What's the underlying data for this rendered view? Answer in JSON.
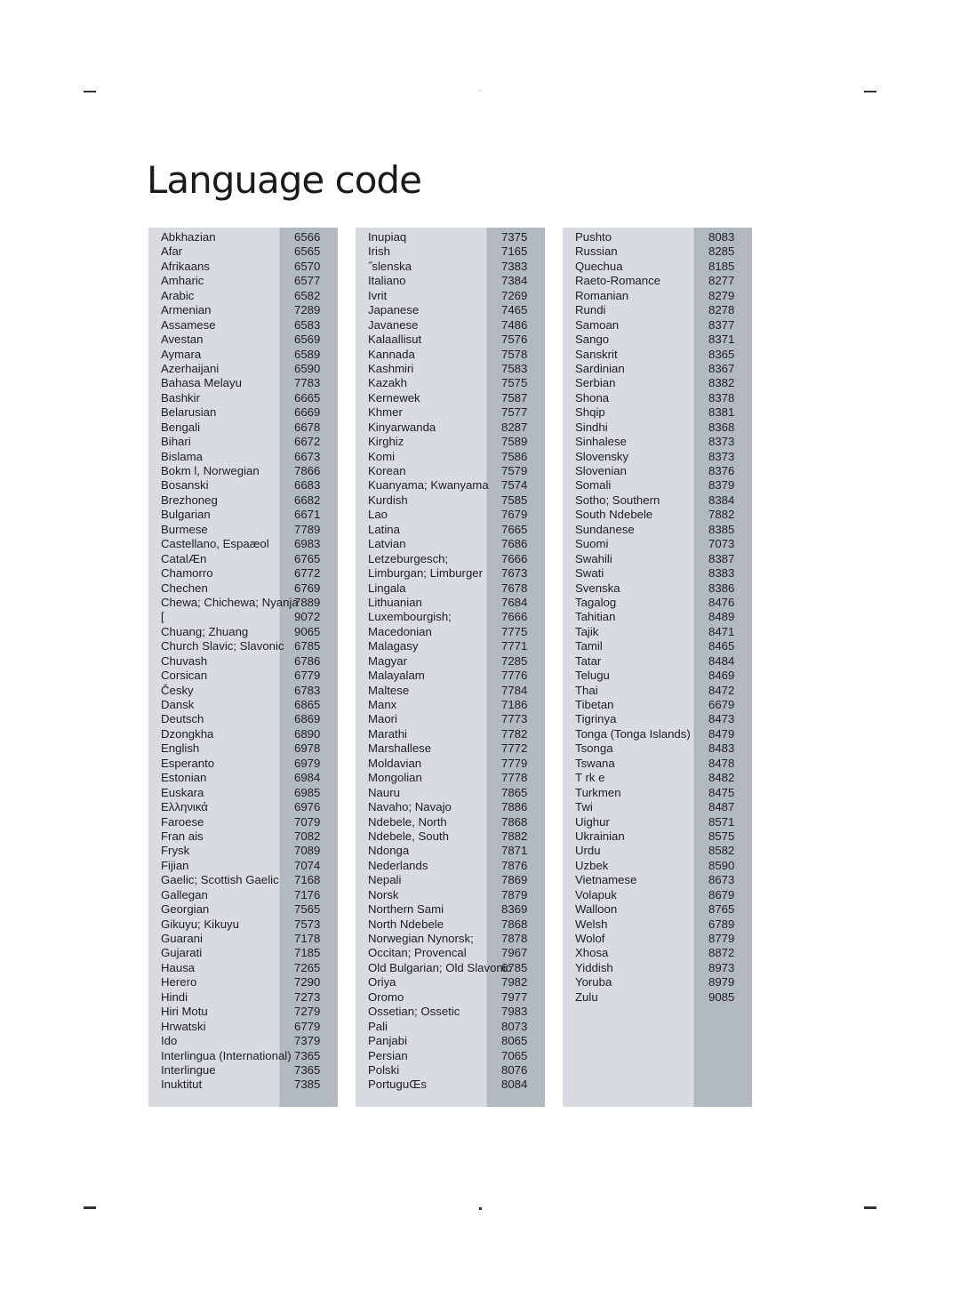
{
  "page": {
    "title": "Language code"
  },
  "columns": [
    {
      "entries": [
        {
          "name": "Abkhazian",
          "code": "6566"
        },
        {
          "name": "Afar",
          "code": "6565"
        },
        {
          "name": "Afrikaans",
          "code": "6570"
        },
        {
          "name": "Amharic",
          "code": "6577"
        },
        {
          "name": "Arabic",
          "code": "6582"
        },
        {
          "name": "Armenian",
          "code": "7289"
        },
        {
          "name": "Assamese",
          "code": "6583"
        },
        {
          "name": "Avestan",
          "code": "6569"
        },
        {
          "name": "Aymara",
          "code": "6589"
        },
        {
          "name": "Azerhaijani",
          "code": "6590"
        },
        {
          "name": "Bahasa Melayu",
          "code": "7783"
        },
        {
          "name": "Bashkir",
          "code": "6665"
        },
        {
          "name": "Belarusian",
          "code": "6669"
        },
        {
          "name": "Bengali",
          "code": "6678"
        },
        {
          "name": "Bihari",
          "code": "6672"
        },
        {
          "name": "Bislama",
          "code": "6673"
        },
        {
          "name": "Bokm l, Norwegian",
          "code": "7866"
        },
        {
          "name": "Bosanski",
          "code": "6683"
        },
        {
          "name": "Brezhoneg",
          "code": "6682"
        },
        {
          "name": "Bulgarian",
          "code": "6671"
        },
        {
          "name": "Burmese",
          "code": "7789"
        },
        {
          "name": "Castellano, Espaæol",
          "code": "6983"
        },
        {
          "name": "CatalÆn",
          "code": "6765"
        },
        {
          "name": "Chamorro",
          "code": "6772"
        },
        {
          "name": "Chechen",
          "code": "6769"
        },
        {
          "name": "Chewa; Chichewa; Nyanja",
          "code": "7889"
        },
        {
          "name": "[",
          "code": "9072"
        },
        {
          "name": "Chuang; Zhuang",
          "code": "9065"
        },
        {
          "name": "Church Slavic; Slavonic",
          "code": "6785"
        },
        {
          "name": "Chuvash",
          "code": "6786"
        },
        {
          "name": "Corsican",
          "code": "6779"
        },
        {
          "name": "Česky",
          "code": "6783"
        },
        {
          "name": "Dansk",
          "code": "6865"
        },
        {
          "name": "Deutsch",
          "code": "6869"
        },
        {
          "name": "Dzongkha",
          "code": "6890"
        },
        {
          "name": "English",
          "code": "6978"
        },
        {
          "name": "Esperanto",
          "code": "6979"
        },
        {
          "name": "Estonian",
          "code": "6984"
        },
        {
          "name": "Euskara",
          "code": "6985"
        },
        {
          "name": "Ελληνικά",
          "code": "6976"
        },
        {
          "name": "Faroese",
          "code": "7079"
        },
        {
          "name": "Fran ais",
          "code": "7082"
        },
        {
          "name": "Frysk",
          "code": "7089"
        },
        {
          "name": "Fijian",
          "code": "7074"
        },
        {
          "name": "Gaelic; Scottish Gaelic",
          "code": "7168"
        },
        {
          "name": "Gallegan",
          "code": "7176"
        },
        {
          "name": "Georgian",
          "code": "7565"
        },
        {
          "name": "Gikuyu; Kikuyu",
          "code": "7573"
        },
        {
          "name": "Guarani",
          "code": "7178"
        },
        {
          "name": "Gujarati",
          "code": "7185"
        },
        {
          "name": "Hausa",
          "code": "7265"
        },
        {
          "name": "Herero",
          "code": "7290"
        },
        {
          "name": "Hindi",
          "code": "7273"
        },
        {
          "name": "Hiri Motu",
          "code": "7279"
        },
        {
          "name": "Hrwatski",
          "code": "6779"
        },
        {
          "name": "Ido",
          "code": "7379"
        },
        {
          "name": "Interlingua (International)",
          "code": "7365"
        },
        {
          "name": "Interlingue",
          "code": "7365"
        },
        {
          "name": "Inuktitut",
          "code": "7385"
        }
      ]
    },
    {
      "entries": [
        {
          "name": "Inupiaq",
          "code": "7375"
        },
        {
          "name": "Irish",
          "code": "7165"
        },
        {
          "name": "˝slenska",
          "code": "7383"
        },
        {
          "name": "Italiano",
          "code": "7384"
        },
        {
          "name": "Ivrit",
          "code": "7269"
        },
        {
          "name": "Japanese",
          "code": "7465"
        },
        {
          "name": "Javanese",
          "code": "7486"
        },
        {
          "name": "Kalaallisut",
          "code": "7576"
        },
        {
          "name": "Kannada",
          "code": "7578"
        },
        {
          "name": "Kashmiri",
          "code": "7583"
        },
        {
          "name": "Kazakh",
          "code": "7575"
        },
        {
          "name": "Kernewek",
          "code": "7587"
        },
        {
          "name": "Khmer",
          "code": "7577"
        },
        {
          "name": "Kinyarwanda",
          "code": "8287"
        },
        {
          "name": "Kirghiz",
          "code": "7589"
        },
        {
          "name": "Komi",
          "code": "7586"
        },
        {
          "name": "Korean",
          "code": "7579"
        },
        {
          "name": "Kuanyama; Kwanyama",
          "code": "7574"
        },
        {
          "name": "Kurdish",
          "code": "7585"
        },
        {
          "name": "Lao",
          "code": "7679"
        },
        {
          "name": "Latina",
          "code": "7665"
        },
        {
          "name": "Latvian",
          "code": "7686"
        },
        {
          "name": "Letzeburgesch;",
          "code": "7666"
        },
        {
          "name": "Limburgan; Limburger",
          "code": "7673"
        },
        {
          "name": "Lingala",
          "code": "7678"
        },
        {
          "name": "Lithuanian",
          "code": "7684"
        },
        {
          "name": "Luxembourgish;",
          "code": "7666"
        },
        {
          "name": "Macedonian",
          "code": "7775"
        },
        {
          "name": "Malagasy",
          "code": "7771"
        },
        {
          "name": "Magyar",
          "code": "7285"
        },
        {
          "name": "Malayalam",
          "code": "7776"
        },
        {
          "name": "Maltese",
          "code": "7784"
        },
        {
          "name": "Manx",
          "code": "7186"
        },
        {
          "name": "Maori",
          "code": "7773"
        },
        {
          "name": "Marathi",
          "code": "7782"
        },
        {
          "name": "Marshallese",
          "code": "7772"
        },
        {
          "name": "Moldavian",
          "code": "7779"
        },
        {
          "name": "Mongolian",
          "code": "7778"
        },
        {
          "name": "Nauru",
          "code": "7865"
        },
        {
          "name": "Navaho; Navajo",
          "code": "7886"
        },
        {
          "name": "Ndebele, North",
          "code": "7868"
        },
        {
          "name": "Ndebele, South",
          "code": "7882"
        },
        {
          "name": "Ndonga",
          "code": "7871"
        },
        {
          "name": "Nederlands",
          "code": "7876"
        },
        {
          "name": "Nepali",
          "code": "7869"
        },
        {
          "name": "Norsk",
          "code": "7879"
        },
        {
          "name": "Northern Sami",
          "code": "8369"
        },
        {
          "name": "North Ndebele",
          "code": "7868"
        },
        {
          "name": "Norwegian Nynorsk;",
          "code": "7878"
        },
        {
          "name": "Occitan; Provencal",
          "code": "7967"
        },
        {
          "name": "Old Bulgarian; Old Slavonic",
          "code": "6785"
        },
        {
          "name": "Oriya",
          "code": "7982"
        },
        {
          "name": "Oromo",
          "code": "7977"
        },
        {
          "name": "Ossetian; Ossetic",
          "code": "7983"
        },
        {
          "name": "Pali",
          "code": "8073"
        },
        {
          "name": "Panjabi",
          "code": "8065"
        },
        {
          "name": "Persian",
          "code": "7065"
        },
        {
          "name": "Polski",
          "code": "8076"
        },
        {
          "name": "PortuguŒs",
          "code": "8084"
        }
      ]
    },
    {
      "entries": [
        {
          "name": "Pushto",
          "code": "8083"
        },
        {
          "name": "Russian",
          "code": "8285"
        },
        {
          "name": "Quechua",
          "code": "8185"
        },
        {
          "name": "Raeto-Romance",
          "code": "8277"
        },
        {
          "name": "Romanian",
          "code": "8279"
        },
        {
          "name": "Rundi",
          "code": "8278"
        },
        {
          "name": "Samoan",
          "code": "8377"
        },
        {
          "name": "Sango",
          "code": "8371"
        },
        {
          "name": "Sanskrit",
          "code": "8365"
        },
        {
          "name": "Sardinian",
          "code": "8367"
        },
        {
          "name": "Serbian",
          "code": "8382"
        },
        {
          "name": "Shona",
          "code": "8378"
        },
        {
          "name": "Shqip",
          "code": "8381"
        },
        {
          "name": "Sindhi",
          "code": "8368"
        },
        {
          "name": "Sinhalese",
          "code": "8373"
        },
        {
          "name": "Slovensky",
          "code": "8373"
        },
        {
          "name": "Slovenian",
          "code": "8376"
        },
        {
          "name": "Somali",
          "code": "8379"
        },
        {
          "name": "Sotho; Southern",
          "code": "8384"
        },
        {
          "name": "South Ndebele",
          "code": "7882"
        },
        {
          "name": "Sundanese",
          "code": "8385"
        },
        {
          "name": "Suomi",
          "code": "7073"
        },
        {
          "name": "Swahili",
          "code": "8387"
        },
        {
          "name": "Swati",
          "code": "8383"
        },
        {
          "name": "Svenska",
          "code": "8386"
        },
        {
          "name": "Tagalog",
          "code": "8476"
        },
        {
          "name": "Tahitian",
          "code": "8489"
        },
        {
          "name": "Tajik",
          "code": "8471"
        },
        {
          "name": "Tamil",
          "code": "8465"
        },
        {
          "name": "Tatar",
          "code": "8484"
        },
        {
          "name": "Telugu",
          "code": "8469"
        },
        {
          "name": "Thai",
          "code": "8472"
        },
        {
          "name": "Tibetan",
          "code": "6679"
        },
        {
          "name": "Tigrinya",
          "code": "8473"
        },
        {
          "name": "Tonga (Tonga Islands)",
          "code": "8479"
        },
        {
          "name": "Tsonga",
          "code": "8483"
        },
        {
          "name": "Tswana",
          "code": "8478"
        },
        {
          "name": "T rk e",
          "code": "8482"
        },
        {
          "name": "Turkmen",
          "code": "8475"
        },
        {
          "name": "Twi",
          "code": "8487"
        },
        {
          "name": "Uighur",
          "code": "8571"
        },
        {
          "name": "Ukrainian",
          "code": "8575"
        },
        {
          "name": "Urdu",
          "code": "8582"
        },
        {
          "name": "Uzbek",
          "code": "8590"
        },
        {
          "name": "Vietnamese",
          "code": "8673"
        },
        {
          "name": "Volapuk",
          "code": "8679"
        },
        {
          "name": "Walloon",
          "code": "8765"
        },
        {
          "name": "Welsh",
          "code": "6789"
        },
        {
          "name": "Wolof",
          "code": "8779"
        },
        {
          "name": "Xhosa",
          "code": "8872"
        },
        {
          "name": "Yiddish",
          "code": "8973"
        },
        {
          "name": "Yoruba",
          "code": "8979"
        },
        {
          "name": "Zulu",
          "code": "9085"
        }
      ]
    }
  ],
  "colors": {
    "panel_background": "#d8dbe0",
    "code_band": "#b3b9c1",
    "text": "#1e1e1e"
  }
}
